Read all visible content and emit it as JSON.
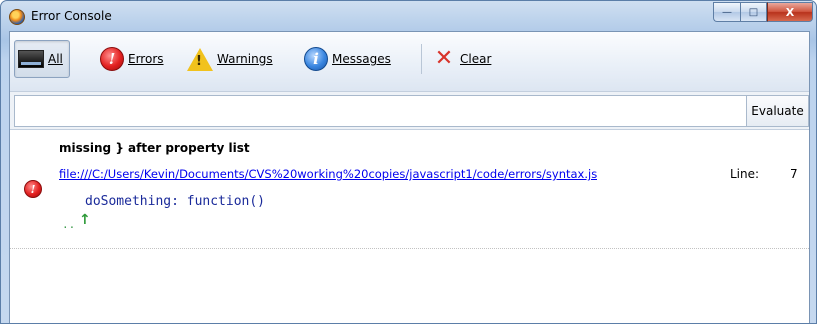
{
  "window": {
    "title": "Error Console",
    "controls": {
      "minimize": "—",
      "maximize": "□",
      "close": "X"
    }
  },
  "toolbar": {
    "buttons": [
      {
        "label": "All",
        "icon": "all-monitor-icon",
        "active": true
      },
      {
        "label": "Errors",
        "icon": "error-icon"
      },
      {
        "label": "Warnings",
        "icon": "warning-icon"
      },
      {
        "label": "Messages",
        "icon": "info-icon"
      },
      {
        "label": "Clear",
        "icon": "clear-x-icon"
      }
    ]
  },
  "evaluate": {
    "input_value": "",
    "button_label": "Evaluate"
  },
  "log": {
    "entries": [
      {
        "type": "error",
        "message": "missing } after property list",
        "file": "file:///C:/Users/Kevin/Documents/CVS%20working%20copies/javascript1/code/errors/syntax.js",
        "line_label": "Line:",
        "line_number": "7",
        "source_line": "doSomething: function()",
        "dots": "..",
        "caret": "↑"
      }
    ]
  },
  "colors": {
    "error_red": "#e32121",
    "warning_yellow": "#f1c21d",
    "info_blue": "#3a86e0",
    "link_blue": "#0000ee",
    "source_text": "#1a2a9a",
    "caret_green": "#2f9a3a"
  }
}
